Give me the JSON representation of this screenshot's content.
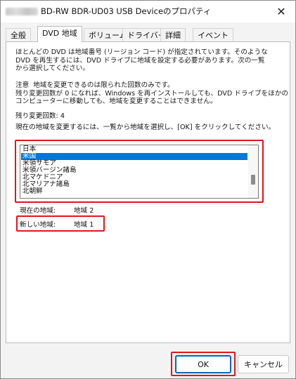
{
  "window": {
    "title": "BD-RW   BDR-UD03 USB Deviceのプロパティ",
    "close_label": "✕"
  },
  "tabs": [
    {
      "label": "全般"
    },
    {
      "label": "DVD 地域"
    },
    {
      "label": "ボリューム"
    },
    {
      "label": "ドライバー"
    },
    {
      "label": "詳細"
    },
    {
      "label": "イベント"
    }
  ],
  "intro_text": "ほとんどの DVD は地域番号 (リージョン コード) が指定されています。そのような\nDVD を再生するには、DVD ドライブに地域を設定する必要があります。次の一覧\nから選択してください。",
  "note_text": "注意  地域を変更できるのは限られた回数のみです。\n残り変更回数が 0 になれば、Windows を再インストールしても、DVD ドライブをほかの\nコンピューターに移動しても、地域を変更することはできません。",
  "remaining": {
    "label": "残り変更回数:",
    "value": "4"
  },
  "instruction_text": "現在の地域を変更するには、一覧から地域を選択し、[OK] をクリックしてください。",
  "region_list": {
    "items": [
      "日本",
      "米国",
      "米領サモア",
      "米領バージン諸島",
      "北マケドニア",
      "北マリアナ諸島",
      "北朝鮮"
    ],
    "selected_index": 1
  },
  "current_region": {
    "label": "現在の地域:",
    "value": "地域 2"
  },
  "new_region": {
    "label": "新しい地域:",
    "value": "地域 1"
  },
  "buttons": {
    "ok": "OK",
    "cancel": "キャンセル"
  },
  "colors": {
    "highlight": "#e4141b",
    "selection": "#0078d7",
    "ok_border": "#0067c0"
  }
}
